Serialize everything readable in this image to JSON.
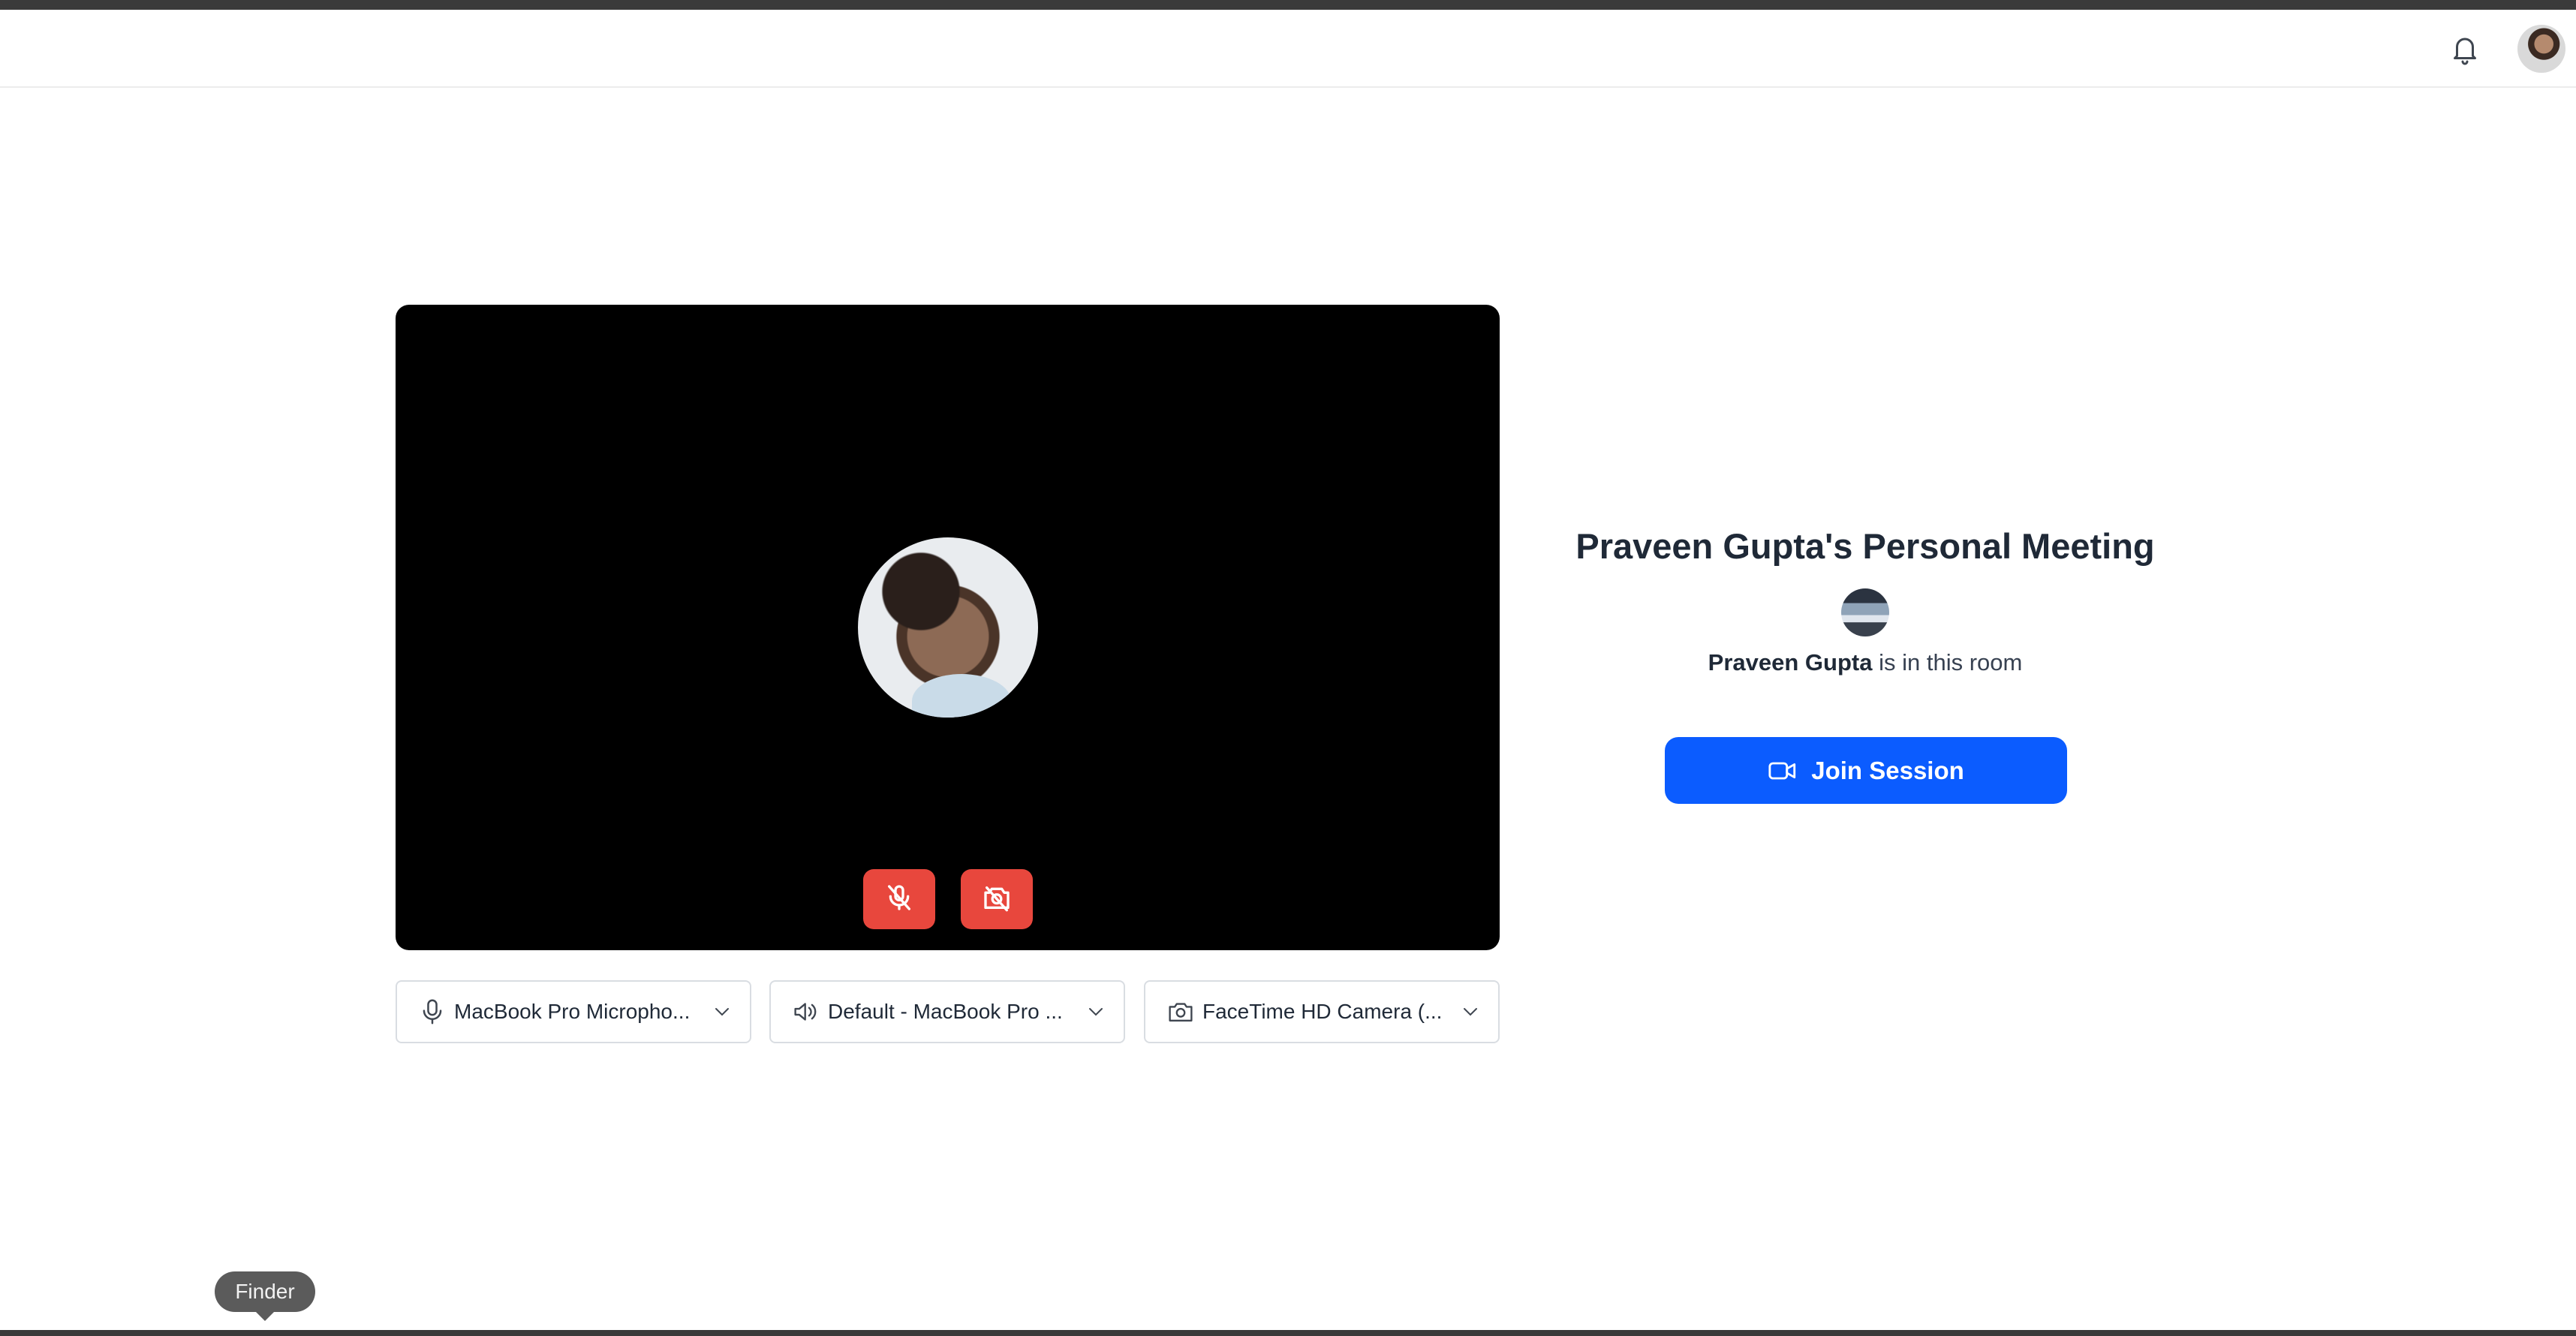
{
  "header": {
    "notifications_icon": "bell-icon",
    "avatar_alt": "User avatar"
  },
  "preview": {
    "mic_button_icon": "mic-off-icon",
    "camera_button_icon": "camera-off-icon",
    "mic_muted": true,
    "camera_off": true,
    "button_color": "#e8473d"
  },
  "devices": {
    "microphone": {
      "label": "MacBook Pro Micropho...",
      "icon": "microphone-icon"
    },
    "speaker": {
      "label": "Default - MacBook Pro ...",
      "icon": "speaker-icon"
    },
    "camera": {
      "label": "FaceTime HD Camera (...",
      "icon": "camera-icon"
    }
  },
  "meeting": {
    "title": "Praveen Gupta's Personal Meeting",
    "host_name": "Praveen Gupta",
    "presence_suffix": " is in this room",
    "join_label": "Join Session",
    "join_icon": "video-icon",
    "accent": "#0b5cff"
  },
  "dock_tooltip": "Finder"
}
